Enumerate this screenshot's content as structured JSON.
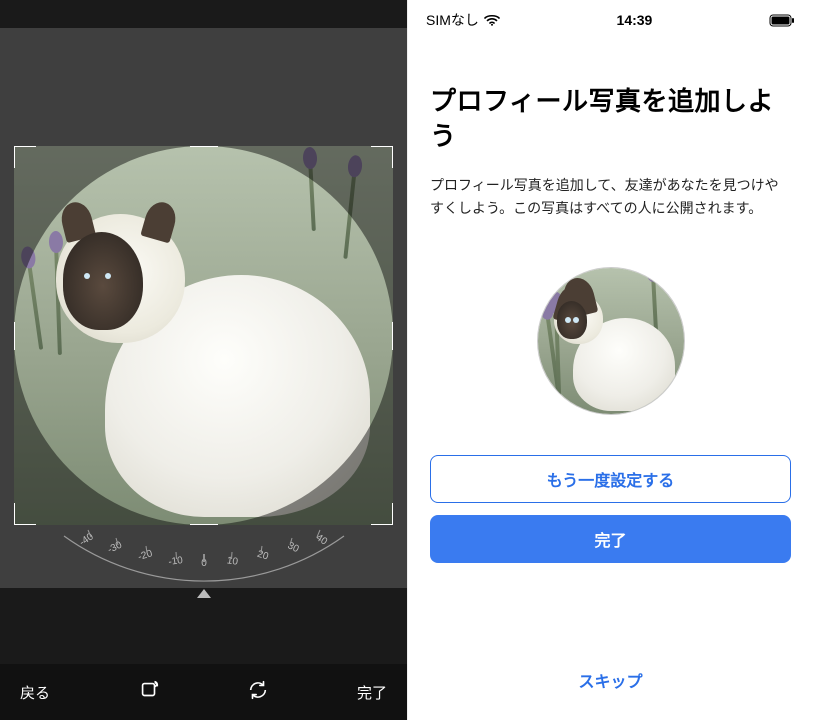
{
  "editor": {
    "back_label": "戻る",
    "done_label": "完了",
    "dial": {
      "ticks": [
        "-40",
        "-30",
        "-20",
        "-10",
        "0",
        "10",
        "20",
        "30",
        "40"
      ],
      "current_value": 0
    },
    "icons": {
      "aspect": "aspect-rotate-icon",
      "flip": "rotate-sync-icon"
    }
  },
  "profile": {
    "status": {
      "carrier": "SIMなし",
      "time": "14:39"
    },
    "title": "プロフィール写真を追加しよう",
    "subtitle": "プロフィール写真を追加して、友達があなたを見つけやすくしよう。この写真はすべての人に公開されます。",
    "retry_label": "もう一度設定する",
    "done_label": "完了",
    "skip_label": "スキップ"
  },
  "colors": {
    "primary": "#3a7bf0",
    "primary_text": "#2a6fe8"
  }
}
